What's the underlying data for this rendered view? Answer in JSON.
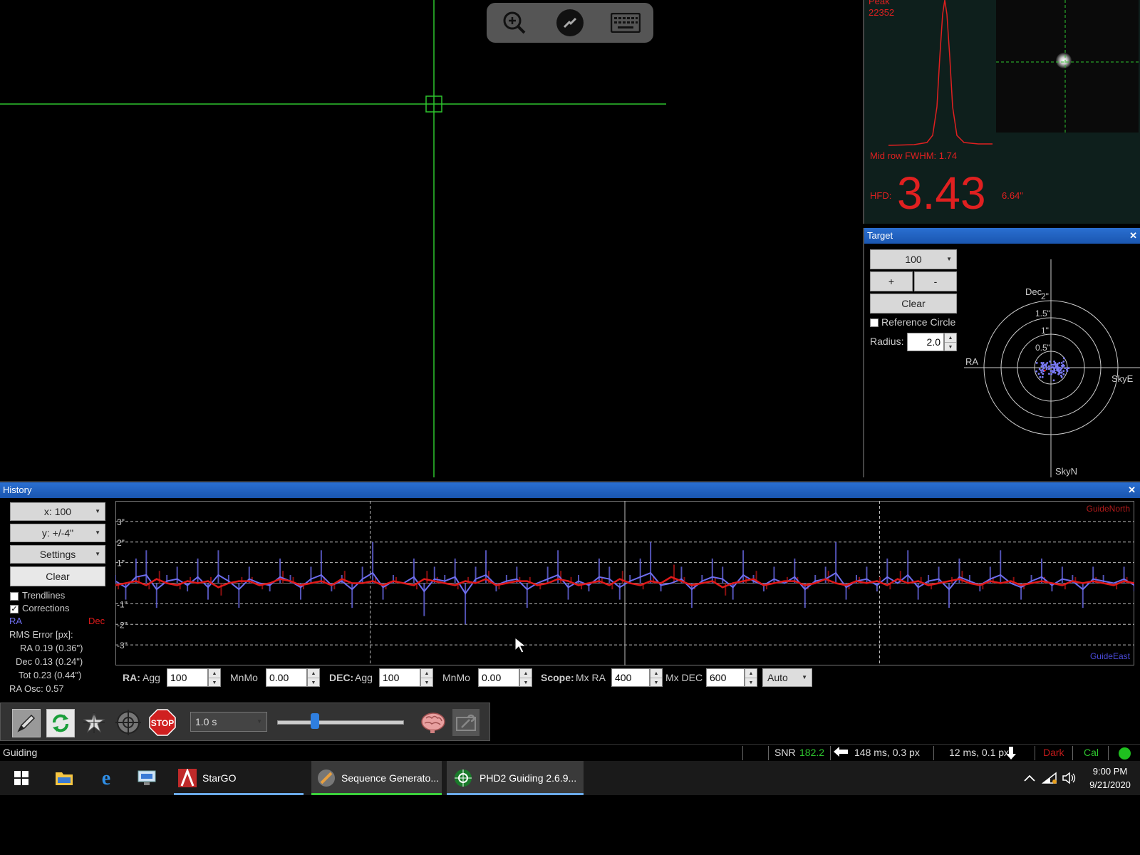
{
  "remote_toolbar": {
    "items": [
      "zoom-in-icon",
      "connection-icon",
      "keyboard-icon"
    ]
  },
  "profile": {
    "peak_label": "Peak",
    "peak_value": "22352",
    "fwhm": "Mid row FWHM: 1.74",
    "hfd_label": "HFD:",
    "hfd_value": "3.43",
    "hfd_arcsec": "6.64\""
  },
  "target": {
    "title": "Target",
    "close": "✕",
    "scale": "100",
    "plus": "+",
    "minus": "-",
    "clear": "Clear",
    "reference_circle": "Reference Circle",
    "radius_label": "Radius:",
    "radius_value": "2.0",
    "axis_dec": "Dec",
    "axis_ra": "RA",
    "axis_skye": "SkyE",
    "axis_skyn": "SkyN",
    "rings": [
      "2\"",
      "1.5\"",
      "1\"",
      "0.5\""
    ]
  },
  "history": {
    "title": "History",
    "close": "✕",
    "x_scale": "x: 100",
    "y_scale": "y: +/-4\"",
    "settings": "Settings",
    "clear": "Clear",
    "trendlines": "Trendlines",
    "corrections": "Corrections",
    "legend_ra": "RA",
    "legend_dec": "Dec",
    "rms_title": "RMS Error [px]:",
    "rms_ra": "RA  0.19 (0.36\")",
    "rms_dec": "Dec  0.13 (0.24\")",
    "rms_tot": "Tot  0.23 (0.44\")",
    "ra_osc": "RA Osc: 0.57",
    "guide_north": "GuideNorth",
    "guide_east": "GuideEast",
    "y_ticks": [
      "3\"",
      "2\"",
      "1\"",
      "-1\"",
      "-2\"",
      "-3\""
    ],
    "ra_color": "#6e6ef0",
    "dec_color": "#e01a1a"
  },
  "params": {
    "ra_label": "RA:",
    "ra_agg_label": "Agg",
    "ra_agg": "100",
    "ra_mnmo_label": "MnMo",
    "ra_mnmo": "0.00",
    "dec_label": "DEC:",
    "dec_agg_label": "Agg",
    "dec_agg": "100",
    "dec_mnmo_label": "MnMo",
    "dec_mnmo": "0.00",
    "scope_label": "Scope:",
    "mx_ra_label": "Mx RA",
    "mx_ra": "400",
    "mx_dec_label": "Mx DEC",
    "mx_dec": "600",
    "mode": "Auto"
  },
  "toolbar": {
    "exposure": "1.0 s",
    "stop": "STOP"
  },
  "status": {
    "state": "Guiding",
    "snr_label": "SNR",
    "snr_value": "182.2",
    "ra_pulse": "148 ms, 0.3 px",
    "dec_pulse": "12 ms, 0.1 px",
    "dark": "Dark",
    "cal": "Cal"
  },
  "taskbar": {
    "apps": [
      "StarGO",
      "Sequence Generato...",
      "PHD2 Guiding 2.6.9..."
    ],
    "time": "9:00 PM",
    "date": "9/21/2020"
  },
  "chart_data": {
    "type": "line",
    "title": "",
    "ylim": [
      -4,
      4
    ],
    "y_unit": "arcsec",
    "series": [
      {
        "name": "RA",
        "values": [
          0.1,
          -0.2,
          0.3,
          0.4,
          -0.3,
          0.1,
          0.2,
          -0.1,
          0.3,
          -0.2,
          0.4,
          0.1,
          -0.3,
          0.2,
          0.0,
          -0.1,
          0.3,
          0.1,
          -0.2,
          0.2,
          0.4,
          -0.1,
          0.1,
          -0.3,
          0.2,
          0.5,
          -0.2,
          0.1,
          0.0,
          0.3,
          -0.4,
          0.2,
          0.1,
          0.3,
          -0.5,
          0.2,
          0.4,
          -0.1,
          0.1,
          0.2,
          -0.3,
          0.0,
          0.2,
          0.4,
          -0.2,
          0.1,
          -0.1,
          0.3,
          0.2,
          -0.2,
          0.1,
          0.3,
          0.5,
          -0.1,
          0.0,
          0.2,
          -0.3,
          0.1,
          0.3,
          0.2,
          -0.2,
          0.4,
          0.1,
          -0.1,
          0.2,
          0.0,
          0.3,
          -0.3,
          0.1,
          0.2,
          0.5,
          -0.2,
          0.1,
          0.2,
          -0.1,
          0.3,
          0.0,
          0.4,
          -0.2,
          0.1,
          0.2,
          -0.3,
          0.3,
          0.1,
          -0.1,
          0.2,
          0.4,
          0.0,
          -0.2,
          0.1,
          0.3,
          -0.1,
          0.2,
          0.1,
          -0.3,
          0.2,
          0.1,
          0.0,
          0.2,
          -0.1
        ]
      },
      {
        "name": "Dec",
        "values": [
          -0.1,
          0.0,
          0.1,
          -0.1,
          0.2,
          0.0,
          -0.1,
          0.1,
          0.0,
          0.1,
          -0.2,
          0.0,
          0.1,
          0.1,
          -0.1,
          0.0,
          0.2,
          0.1,
          -0.1,
          0.0,
          0.1,
          -0.1,
          0.2,
          0.0,
          0.0,
          0.1,
          -0.1,
          0.1,
          0.0,
          -0.1,
          0.2,
          0.1,
          0.0,
          -0.1,
          0.1,
          0.0,
          0.2,
          -0.1,
          0.0,
          0.1,
          0.1,
          -0.1,
          0.0,
          0.2,
          0.1,
          -0.1,
          0.0,
          0.1,
          -0.1,
          0.2,
          0.0,
          -0.1,
          0.1,
          0.0,
          0.3,
          0.1,
          -0.1,
          0.0,
          0.1,
          -0.2,
          0.0,
          0.1,
          0.2,
          -0.1,
          0.0,
          0.1,
          0.1,
          -0.1,
          0.0,
          0.2,
          0.0,
          -0.1,
          0.1,
          0.0,
          0.1,
          -0.1,
          0.2,
          0.0,
          0.1,
          -0.1,
          0.0,
          0.1,
          0.2,
          0.0,
          -0.1,
          0.1,
          0.0,
          0.1,
          -0.1,
          0.0,
          0.1,
          0.0,
          -0.1,
          0.1,
          0.0,
          0.1,
          0.0,
          -0.1,
          0.1,
          0.0
        ]
      }
    ]
  }
}
